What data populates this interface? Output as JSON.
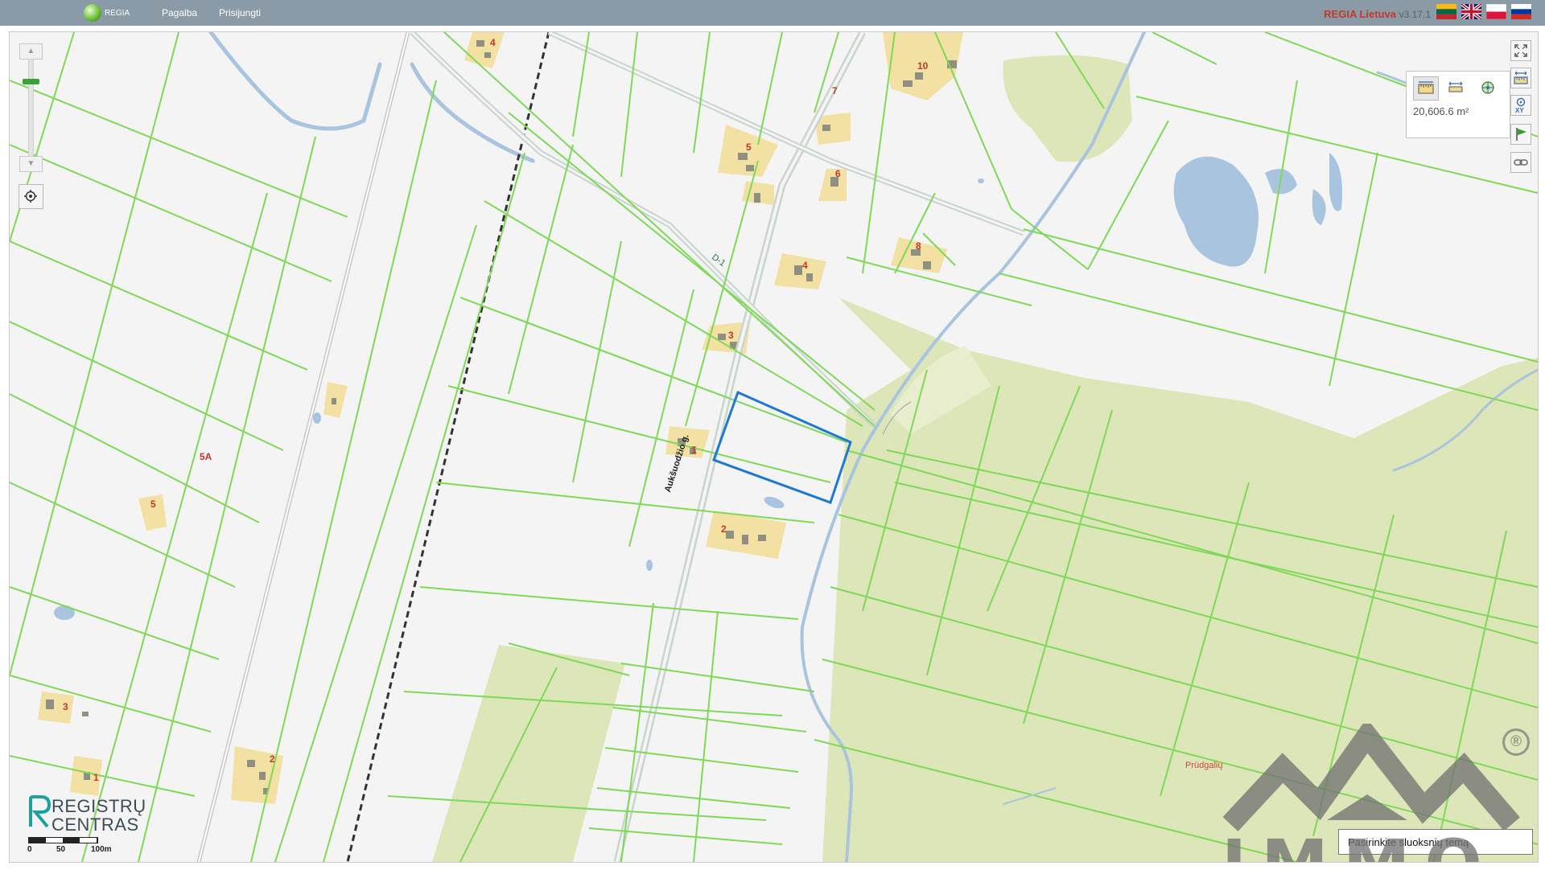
{
  "header": {
    "logo_label": "REGIA",
    "nav": [
      {
        "label": "Pagalba"
      },
      {
        "label": "Prisijungti"
      }
    ],
    "brand": "REGIA Lietuva",
    "version": "v3.17.1",
    "languages": [
      {
        "code": "lt",
        "icon": "flag-lithuania-icon"
      },
      {
        "code": "en",
        "icon": "flag-uk-icon"
      },
      {
        "code": "pl",
        "icon": "flag-poland-icon"
      },
      {
        "code": "ru",
        "icon": "flag-russia-icon"
      }
    ]
  },
  "map": {
    "zoom_up_icon": "▲",
    "zoom_down_icon": "▼",
    "measure": {
      "tools": [
        "measure-area-icon",
        "measure-distance-icon",
        "measure-point-icon"
      ],
      "result": "20,606.6 m²"
    },
    "right_toolbar": [
      "fullscreen-icon",
      "measure-icon",
      "coordinates-xy-icon",
      "flag-marker-icon",
      "link-icon"
    ],
    "labels": {
      "road_name": "Aukšuodžio g.",
      "road_code": "D-1",
      "place_name": "Prūdgalių",
      "parcel_5a": "5A",
      "h4_top": "4",
      "h10": "10",
      "h7": "7",
      "h5_top": "5",
      "h6": "6",
      "h8": "8",
      "h4_mid": "4",
      "h3_mid": "3",
      "h1_mid": "1",
      "h2_mid": "2",
      "h5_left": "5",
      "h3_left": "3",
      "h1_left": "1",
      "h2_left": "2"
    },
    "provider": {
      "line1": "REGISTRŲ",
      "line2": "CENTRAS"
    },
    "scale": [
      "0",
      "50",
      "100m"
    ],
    "layer_select": "Pasirinkite sluoksnių temą",
    "watermark": {
      "text": "IMMO.LT",
      "registered": "®"
    },
    "colors": {
      "parcel_border": "#7ed957",
      "forest": "#dce6b8",
      "water": "#a9c4de",
      "building_plot": "#f3e0a3",
      "building": "#8f8f82",
      "selection": "#1f78d1",
      "road": "#c8d3cc"
    }
  }
}
